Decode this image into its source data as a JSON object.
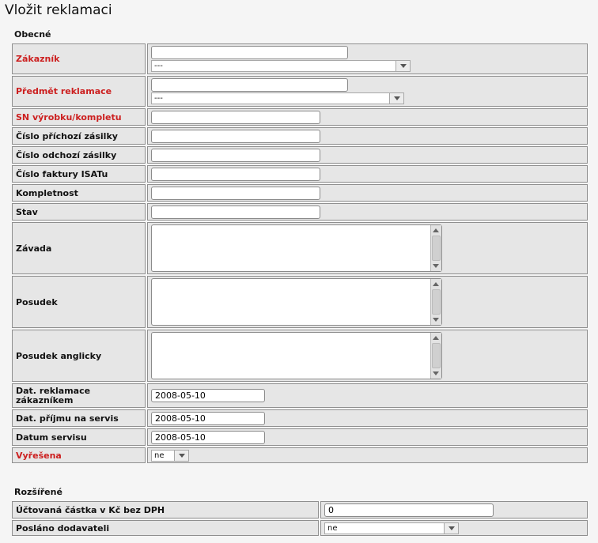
{
  "page_title": "Vložit reklamaci",
  "sections": {
    "general": "Obecné",
    "extended": "Rozšířené"
  },
  "fields": {
    "customer": {
      "label": "Zákazník",
      "value": "",
      "select": "---"
    },
    "subject": {
      "label": "Předmět reklamace",
      "value": "",
      "select": "---"
    },
    "serial": {
      "label": "SN výrobku/kompletu",
      "value": ""
    },
    "incoming": {
      "label": "Číslo příchozí zásilky",
      "value": ""
    },
    "outgoing": {
      "label": "Číslo odchozí zásilky",
      "value": ""
    },
    "invoice": {
      "label": "Číslo faktury ISATu",
      "value": ""
    },
    "complete": {
      "label": "Kompletnost",
      "value": ""
    },
    "state": {
      "label": "Stav",
      "value": ""
    },
    "defect": {
      "label": "Závada",
      "value": ""
    },
    "assessment": {
      "label": "Posudek",
      "value": ""
    },
    "assessment_en": {
      "label": "Posudek anglicky",
      "value": ""
    },
    "claim_date": {
      "label": "Dat. reklamace zákazníkem",
      "value": "2008-05-10"
    },
    "service_receipt": {
      "label": "Dat. příjmu na servis",
      "value": "2008-05-10"
    },
    "service_date": {
      "label": "Datum servisu",
      "value": "2008-05-10"
    },
    "resolved": {
      "label": "Vyřešena",
      "select": "ne"
    },
    "amount": {
      "label": "Účtovaná částka v Kč bez DPH",
      "value": "0"
    },
    "sent_supplier": {
      "label": "Posláno dodavateli",
      "select": "ne"
    }
  },
  "colors": {
    "required_label": "#cc1f1f",
    "row_bg": "#e6e6e6",
    "page_bg": "#f5f5f5"
  }
}
